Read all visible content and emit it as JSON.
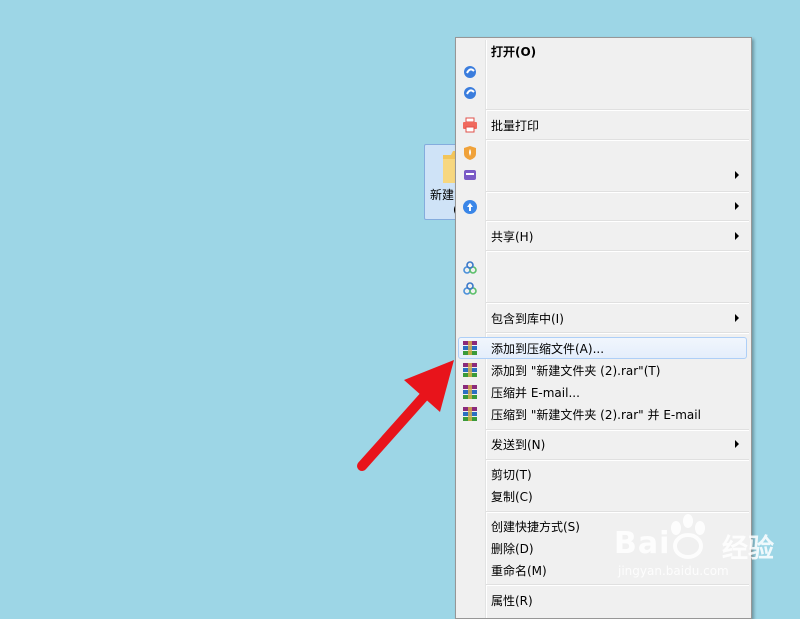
{
  "desktop": {
    "folder_label": "新建",
    "folder_label_line2": "("
  },
  "context_menu": {
    "open": "打开(O)",
    "batch_print": "批量打印",
    "share": "共享(H)",
    "include_in_library": "包含到库中(I)",
    "add_to_archive": "添加到压缩文件(A)...",
    "add_to_named_rar": "添加到 \"新建文件夹 (2).rar\"(T)",
    "compress_and_email": "压缩并 E-mail...",
    "compress_to_rar_and_email": "压缩到 \"新建文件夹 (2).rar\" 并 E-mail",
    "send_to": "发送到(N)",
    "cut": "剪切(T)",
    "copy": "复制(C)",
    "create_shortcut": "创建快捷方式(S)",
    "delete": "删除(D)",
    "rename": "重命名(M)",
    "properties": "属性(R)",
    "highlighted_item": "add_to_archive"
  },
  "watermark": {
    "brand": "Bai",
    "brand_suffix": "经验",
    "url": "jingyan.baidu.com"
  },
  "colors": {
    "desktop_bg": "#9dd6e6",
    "menu_bg": "#f0f0f0",
    "arrow": "#e8141b",
    "highlight_border": "#aecff7"
  }
}
